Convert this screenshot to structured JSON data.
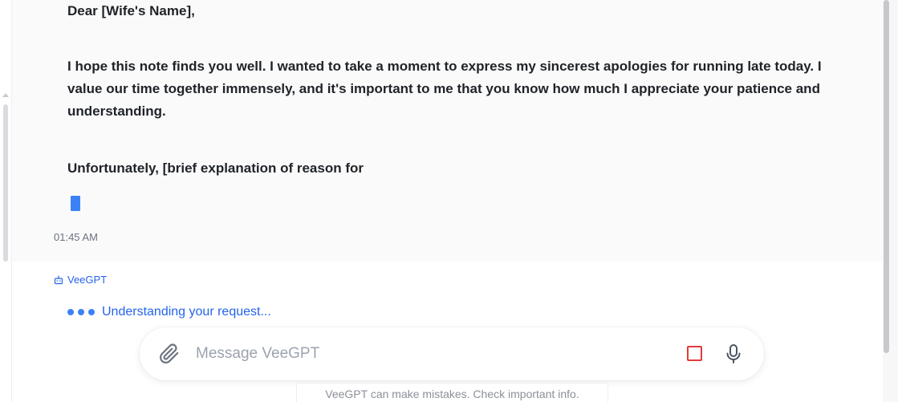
{
  "message": {
    "greeting": "Dear [Wife's Name],",
    "paragraph1": "I hope this note finds you well. I wanted to take a moment to express my sincerest apologies for running late today. I value our time together immensely, and it's important to me that you know how much I appreciate your patience and understanding.",
    "paragraph2": "Unfortunately, [brief explanation of reason for",
    "timestamp": "01:45 AM"
  },
  "bot": {
    "name": "VeeGPT",
    "icon": "robot-icon",
    "status_text": "Understanding your request..."
  },
  "composer": {
    "placeholder": "Message VeeGPT",
    "value": "",
    "attach_icon": "paperclip-icon",
    "stop_icon": "stop-square-icon",
    "mic_icon": "microphone-icon"
  },
  "footer": {
    "disclaimer": "VeeGPT can make mistakes. Check important info."
  },
  "colors": {
    "accent": "#2563eb",
    "cursor": "#3b82f6",
    "stop": "#e23b3b"
  }
}
